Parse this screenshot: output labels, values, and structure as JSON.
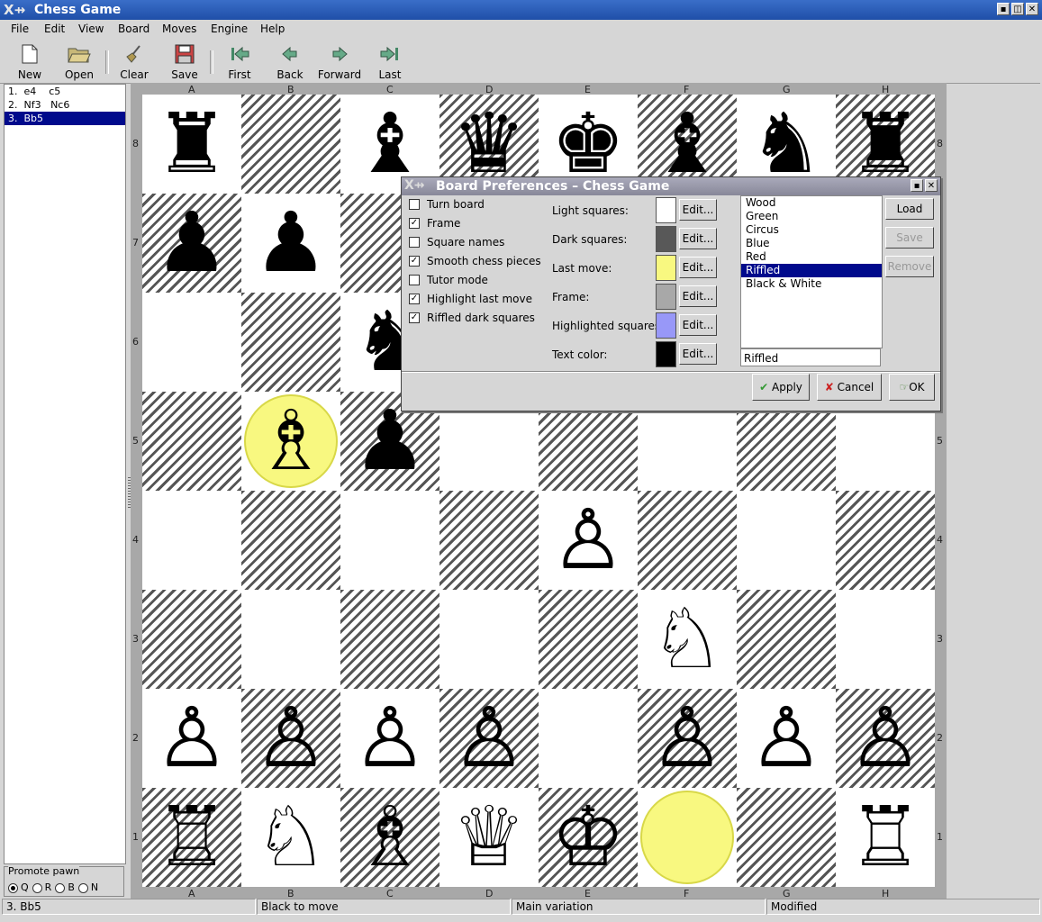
{
  "window": {
    "title": "Chess Game"
  },
  "menu": [
    "File",
    "Edit",
    "View",
    "Board",
    "Moves",
    "Engine",
    "Help"
  ],
  "toolbar": {
    "new": "New",
    "open": "Open",
    "clear": "Clear",
    "save": "Save",
    "first": "First",
    "back": "Back",
    "forward": "Forward",
    "last": "Last"
  },
  "moves": [
    "1.  e4    c5",
    "2.  Nf3   Nc6",
    "3.  Bb5"
  ],
  "promote": {
    "title": "Promote pawn",
    "options": [
      "Q",
      "R",
      "B",
      "N"
    ]
  },
  "board": {
    "files": [
      "A",
      "B",
      "C",
      "D",
      "E",
      "F",
      "G",
      "H"
    ],
    "ranks": [
      "8",
      "7",
      "6",
      "5",
      "4",
      "3",
      "2",
      "1"
    ],
    "rows": [
      [
        "♜",
        "",
        "♝",
        "♛",
        "♚",
        "♝",
        "♞",
        "♜"
      ],
      [
        "♟",
        "♟",
        "",
        "",
        "",
        "",
        "",
        ""
      ],
      [
        "",
        "",
        "♞",
        "",
        "",
        "",
        "",
        ""
      ],
      [
        "",
        "♗",
        "♟",
        "",
        "",
        "",
        "",
        ""
      ],
      [
        "",
        "",
        "",
        "",
        "♙",
        "",
        "",
        ""
      ],
      [
        "",
        "",
        "",
        "",
        "",
        "♘",
        "",
        ""
      ],
      [
        "♙",
        "♙",
        "♙",
        "♙",
        "",
        "♙",
        "♙",
        "♙"
      ],
      [
        "♖",
        "♘",
        "♗",
        "♕",
        "♔",
        "",
        "",
        "♖"
      ]
    ],
    "highlight": [
      "b5",
      "f1"
    ]
  },
  "dialog": {
    "title": "Board Preferences – Chess Game",
    "checks": [
      {
        "label": "Turn board",
        "checked": false
      },
      {
        "label": "Frame",
        "checked": true
      },
      {
        "label": "Square names",
        "checked": false
      },
      {
        "label": "Smooth chess pieces",
        "checked": true
      },
      {
        "label": "Tutor mode",
        "checked": false
      },
      {
        "label": "Highlight last move",
        "checked": true
      },
      {
        "label": "Riffled dark squares",
        "checked": true
      }
    ],
    "colors": [
      {
        "label": "Light squares:",
        "color": "#ffffff"
      },
      {
        "label": "Dark squares:",
        "color": "#585858"
      },
      {
        "label": "Last move:",
        "color": "#f8f880"
      },
      {
        "label": "Frame:",
        "color": "#a8a8a8"
      },
      {
        "label": "Highlighted squares:",
        "color": "#9898f8"
      },
      {
        "label": "Text color:",
        "color": "#000000"
      }
    ],
    "edit_label": "Edit...",
    "schemes": [
      "Wood",
      "Green",
      "Circus",
      "Blue",
      "Red",
      "Riffled",
      "Black & White"
    ],
    "selected_scheme": "Riffled",
    "name_value": "Riffled",
    "load": "Load",
    "save": "Save",
    "remove": "Remove",
    "apply": "Apply",
    "cancel": "Cancel",
    "ok": "OK"
  },
  "status": {
    "move": "3. Bb5",
    "turn": "Black to move",
    "variation": "Main variation",
    "modified": "Modified"
  }
}
